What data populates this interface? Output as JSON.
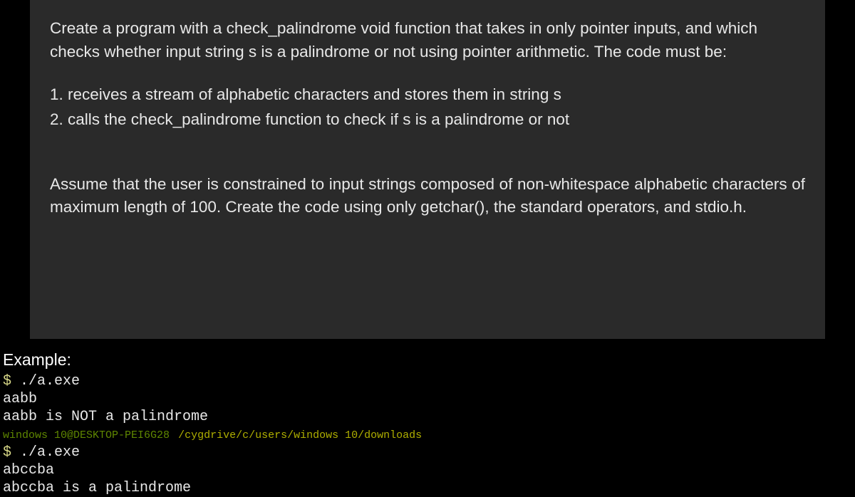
{
  "problem": {
    "intro": "Create a program with a check_palindrome void function that takes in only pointer inputs, and which checks whether input string s is a palindrome or not using pointer arithmetic. The code must be:",
    "req1": "1. receives a stream of alphabetic characters and stores them in string s",
    "req2": "2. calls the check_palindrome function to check if s is a palindrome or not",
    "assume": "Assume that the user is constrained to input strings composed of non-whitespace alphabetic characters of maximum length of 100. Create the code using only getchar(), the standard operators, and stdio.h."
  },
  "example": {
    "label": "Example:",
    "run1_cmd": "./a.exe",
    "run1_input": "aabb",
    "run1_output": "aabb is NOT a palindrome",
    "prompt_user": "windows 10@DESKTOP-PEI6G28",
    "prompt_path": "/cygdrive/c/users/windows 10/downloads",
    "run2_cmd": "./a.exe",
    "run2_input": "abccba",
    "run2_output": "abccba is a palindrome",
    "dollar": "$ "
  }
}
